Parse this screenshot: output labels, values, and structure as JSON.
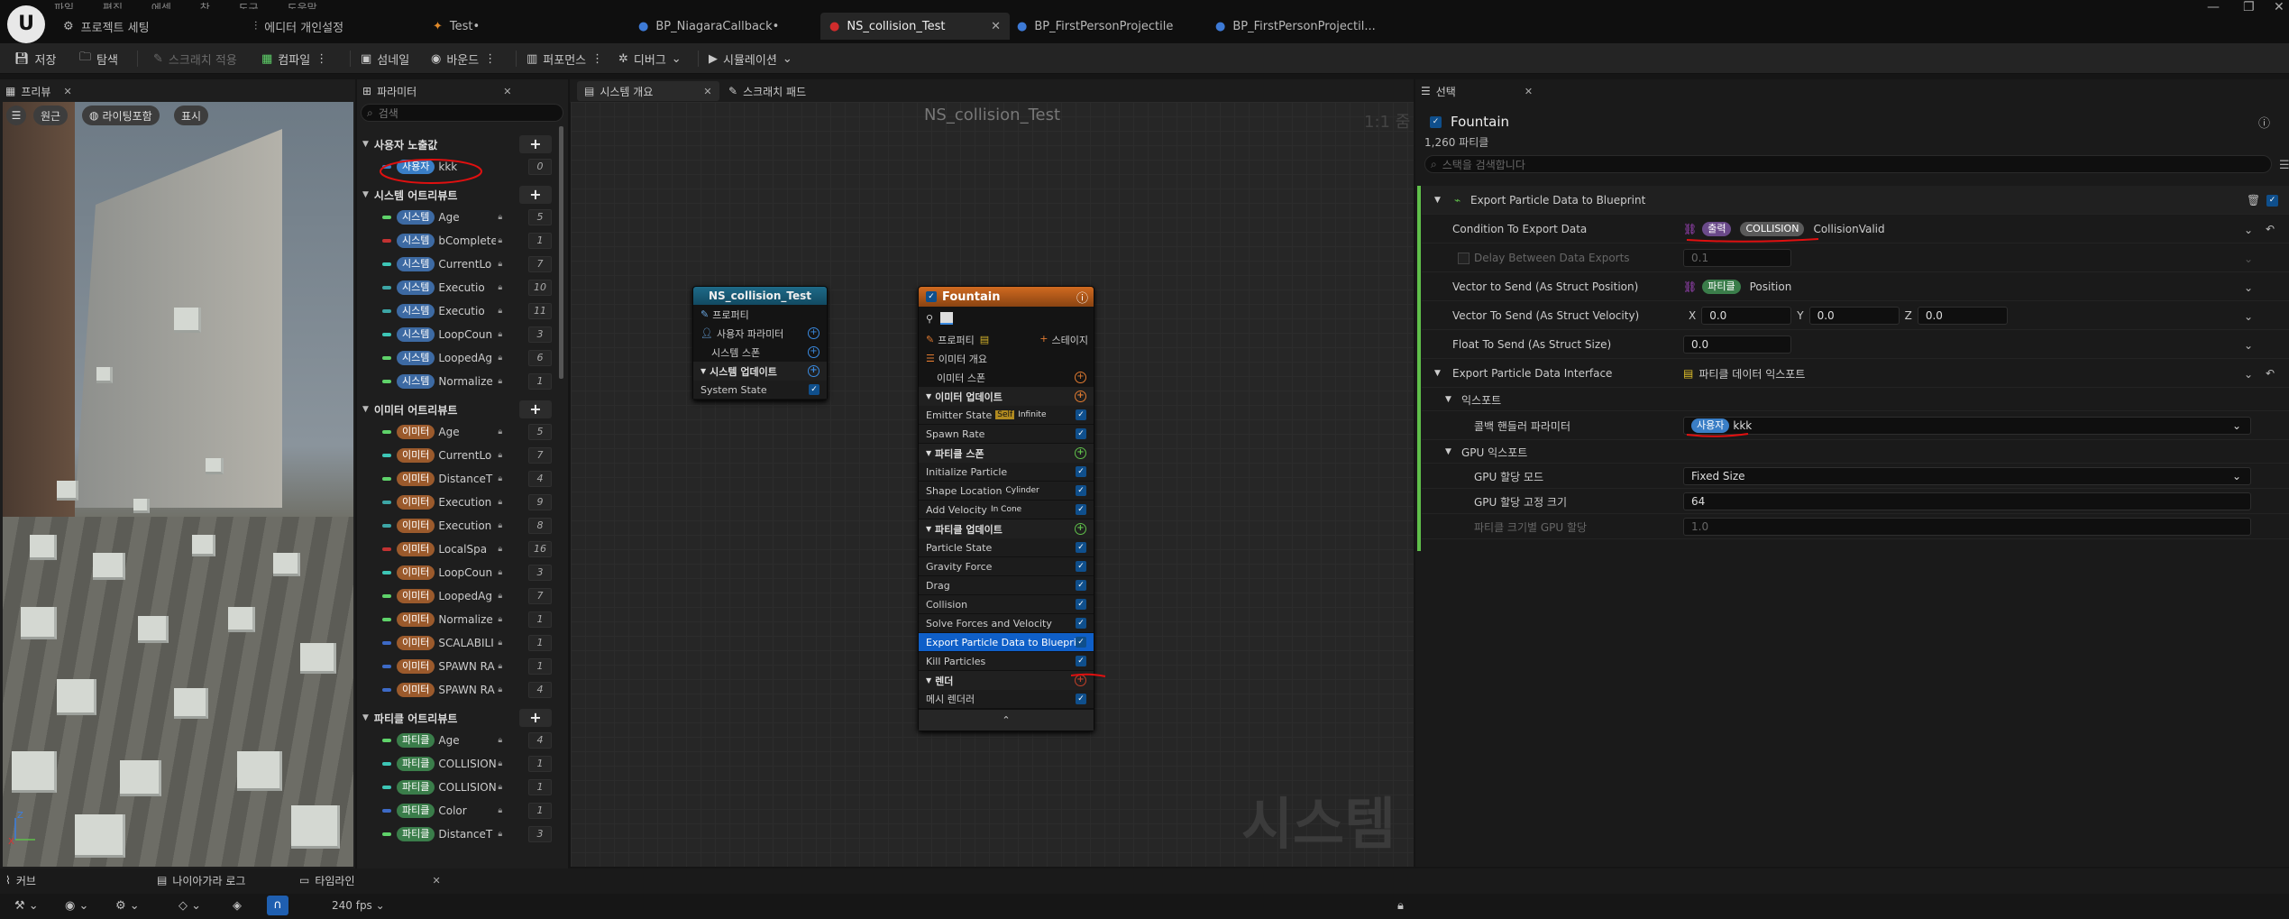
{
  "titlebar": {
    "menu": [
      "파일",
      "편집",
      "에셋",
      "창",
      "도구",
      "도움말"
    ],
    "project_settings": "프로젝트 세팅",
    "editor_prefs": "에디터 개인설정",
    "tabs": [
      "Test•",
      "BP_NiagaraCallback•",
      "NS_collision_Test",
      "BP_FirstPersonProjectile",
      "BP_FirstPersonProjectil..."
    ]
  },
  "toolbar": {
    "save": "저장",
    "browse": "탐색",
    "apply_scratch": "스크래치 적용",
    "compile": "컴파일",
    "thumbnail": "섬네일",
    "bounds": "바운드",
    "performance": "퍼포먼스",
    "debug": "디버그",
    "simulation": "시뮬레이션"
  },
  "preview": {
    "tab": "프리뷰",
    "pills": [
      "원근",
      "라이팅포함",
      "표시"
    ]
  },
  "params": {
    "tab": "파라미터",
    "search_placeholder": "검색",
    "sections": [
      {
        "title": "사용자 노출값",
        "items": [
          {
            "tag": "사용자",
            "name": "kkk",
            "count": "0",
            "color": "#3a7ec6"
          }
        ]
      },
      {
        "title": "시스템 어트리뷰트",
        "items": [
          {
            "tag": "시스템",
            "name": "Age",
            "count": "5",
            "color": "#5fd26a"
          },
          {
            "tag": "시스템",
            "name": "bComplete",
            "count": "1",
            "color": "#c23232"
          },
          {
            "tag": "시스템",
            "name": "CurrentLo",
            "count": "7",
            "color": "#3dc6b6"
          },
          {
            "tag": "시스템",
            "name": "Executio",
            "count": "10",
            "color": "#3da6a6"
          },
          {
            "tag": "시스템",
            "name": "Executio",
            "count": "11",
            "color": "#3da6a6"
          },
          {
            "tag": "시스템",
            "name": "LoopCoun",
            "count": "3",
            "color": "#3dc6b6"
          },
          {
            "tag": "시스템",
            "name": "LoopedAg",
            "count": "6",
            "color": "#5fd26a"
          },
          {
            "tag": "시스템",
            "name": "Normalize",
            "count": "1",
            "color": "#5fd26a"
          }
        ]
      },
      {
        "title": "이미터 어트리뷰트",
        "items": [
          {
            "tag": "이미터",
            "name": "Age",
            "count": "5",
            "color": "#5fd26a"
          },
          {
            "tag": "이미터",
            "name": "CurrentLo",
            "count": "7",
            "color": "#3dc6b6"
          },
          {
            "tag": "이미터",
            "name": "DistanceT",
            "count": "4",
            "color": "#5fd26a"
          },
          {
            "tag": "이미터",
            "name": "Execution",
            "count": "9",
            "color": "#3da6a6"
          },
          {
            "tag": "이미터",
            "name": "Execution",
            "count": "8",
            "color": "#3da6a6"
          },
          {
            "tag": "이미터",
            "name": "LocalSpa",
            "count": "16",
            "color": "#c23232"
          },
          {
            "tag": "이미터",
            "name": "LoopCoun",
            "count": "3",
            "color": "#3dc6b6"
          },
          {
            "tag": "이미터",
            "name": "LoopedAg",
            "count": "7",
            "color": "#5fd26a"
          },
          {
            "tag": "이미터",
            "name": "Normalize",
            "count": "1",
            "color": "#5fd26a"
          },
          {
            "tag": "이미터",
            "name": "SCALABILI",
            "count": "1",
            "color": "#3d6ac6"
          },
          {
            "tag": "이미터",
            "name": "SPAWN RA",
            "count": "1",
            "color": "#3d6ac6"
          },
          {
            "tag": "이미터",
            "name": "SPAWN RA",
            "count": "4",
            "color": "#3d6ac6"
          }
        ]
      },
      {
        "title": "파티클 어트리뷰트",
        "items": [
          {
            "tag": "파티클",
            "name": "Age",
            "count": "4",
            "color": "#5fd26a"
          },
          {
            "tag": "파티클",
            "name": "COLLISION",
            "count": "1",
            "color": "#3dc6b6"
          },
          {
            "tag": "파티클",
            "name": "COLLISION",
            "count": "1",
            "color": "#3dc6b6"
          },
          {
            "tag": "파티클",
            "name": "Color",
            "count": "1",
            "color": "#3d6ac6"
          },
          {
            "tag": "파티클",
            "name": "DistanceT",
            "count": "3",
            "color": "#5fd26a"
          }
        ]
      }
    ]
  },
  "graph": {
    "tab_overview": "시스템 개요",
    "tab_scratch": "스크래치 패드",
    "title": "NS_collision_Test",
    "zoom": "1:1 줌",
    "watermark": "시스템",
    "system_node": {
      "title": "NS_collision_Test",
      "rows": [
        "프로퍼티",
        "사용자 파라미터",
        "시스템 스폰",
        "시스템 업데이트",
        "System State"
      ]
    },
    "emitter_node": {
      "title": "Fountain",
      "properties": "프로퍼티",
      "stage": "스테이지",
      "summary": "이미터 개요",
      "rows": [
        {
          "label": "이미터 스폰",
          "kind": "group",
          "color": "#e07a30"
        },
        {
          "label": "이미터 업데이트",
          "kind": "header",
          "color": "#e07a30"
        },
        {
          "label": "Emitter State",
          "kind": "mod",
          "extra": "Self",
          "extra2": "Infinite"
        },
        {
          "label": "Spawn Rate",
          "kind": "mod"
        },
        {
          "label": "파티클 스폰",
          "kind": "header",
          "color": "#5fbf4a"
        },
        {
          "label": "Initialize Particle",
          "kind": "mod"
        },
        {
          "label": "Shape Location",
          "kind": "mod",
          "extra2": "Cylinder"
        },
        {
          "label": "Add Velocity",
          "kind": "mod",
          "extra2": "In Cone"
        },
        {
          "label": "파티클 업데이트",
          "kind": "header",
          "color": "#5fbf4a"
        },
        {
          "label": "Particle State",
          "kind": "mod"
        },
        {
          "label": "Gravity Force",
          "kind": "mod"
        },
        {
          "label": "Drag",
          "kind": "mod"
        },
        {
          "label": "Collision",
          "kind": "mod"
        },
        {
          "label": "Solve Forces and Velocity",
          "kind": "mod"
        },
        {
          "label": "Export Particle Data to Blueprint",
          "kind": "sel"
        },
        {
          "label": "Kill Particles",
          "kind": "mod"
        },
        {
          "label": "렌더",
          "kind": "header",
          "color": "#c2402a"
        },
        {
          "label": "메시 렌더러",
          "kind": "mod"
        }
      ]
    }
  },
  "details": {
    "tab": "선택",
    "emitter_name": "Fountain",
    "particle_count": "1,260 파티클",
    "search_placeholder": "스택을 검색합니다",
    "module_title": "Export Particle Data to Blueprint",
    "rows": {
      "condition_label": "Condition To Export Data",
      "condition_tag": "출력",
      "condition_tag2": "COLLISION",
      "condition_value": "CollisionValid",
      "delay_label": "Delay Between Data Exports",
      "delay_value": "0.1",
      "vec_pos_label": "Vector to Send (As Struct Position)",
      "vec_pos_tag": "파티클",
      "vec_pos_value": "Position",
      "vec_vel_label": "Vector To Send (As Struct Velocity)",
      "vx_label": "X",
      "vx": "0.0",
      "vy_label": "Y",
      "vy": "0.0",
      "vz_label": "Z",
      "vz": "0.0",
      "float_label": "Float To Send (As Struct Size)",
      "float_value": "0.0",
      "interface_label": "Export Particle Data Interface",
      "interface_value": "파티클 데이터 익스포트",
      "export_section": "익스포트",
      "callback_label": "콜백 핸들러 파라미터",
      "callback_tag": "사용자",
      "callback_value": "kkk",
      "gpu_section": "GPU 익스포트",
      "gpu_mode_label": "GPU 할당 모드",
      "gpu_mode_value": "Fixed Size",
      "gpu_fixed_label": "GPU 할당 고정 크기",
      "gpu_fixed_value": "64",
      "gpu_scale_label": "파티클 크기별 GPU 할당",
      "gpu_scale_value": "1.0"
    }
  },
  "bottom": {
    "tabs": [
      "커브",
      "나이아가라 로그",
      "타임라인"
    ],
    "fps": "240 fps"
  }
}
